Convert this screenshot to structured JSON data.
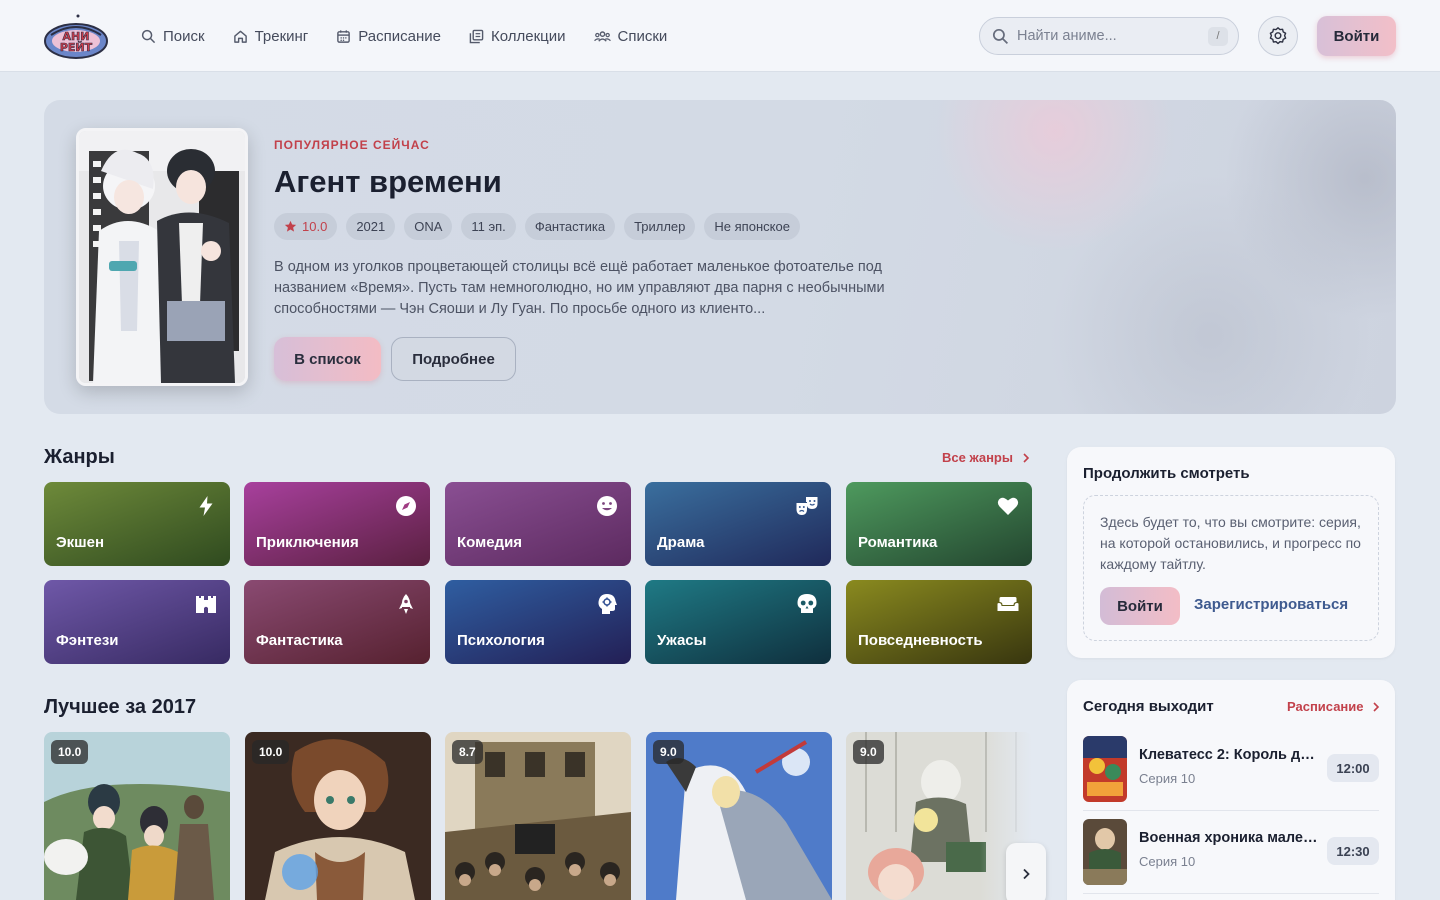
{
  "header": {
    "nav": [
      {
        "label": "Поиск",
        "icon": "search-icon"
      },
      {
        "label": "Трекинг",
        "icon": "home-icon"
      },
      {
        "label": "Расписание",
        "icon": "calendar-icon"
      },
      {
        "label": "Коллекции",
        "icon": "collections-icon"
      },
      {
        "label": "Списки",
        "icon": "users-icon"
      }
    ],
    "search_placeholder": "Найти аниме...",
    "search_shortcut": "/",
    "login_label": "Войти"
  },
  "hero": {
    "kicker": "ПОПУЛЯРНОЕ СЕЙЧАС",
    "title": "Агент времени",
    "rating": "10.0",
    "chips": [
      "2021",
      "ONA",
      "11 эп.",
      "Фантастика",
      "Триллер",
      "Не японское"
    ],
    "description": "В одном из уголков процветающей столицы всё ещё работает маленькое фотоателье под названием «Время». Пусть там немноголюдно, но им управляют два парня с необычными способностями — Чэн Сяоши и Лу Гуан. По просьбе одного из клиенто...",
    "add_label": "В список",
    "more_label": "Подробнее"
  },
  "genres": {
    "title": "Жанры",
    "all_link": "Все жанры",
    "items": [
      {
        "label": "Экшен",
        "icon": "lightning-icon",
        "from": "#6e8a3a",
        "to": "#2f4a1f"
      },
      {
        "label": "Приключения",
        "icon": "compass-icon",
        "from": "#a8409d",
        "to": "#5a2040"
      },
      {
        "label": "Комедия",
        "icon": "smile-icon",
        "from": "#8a4f93",
        "to": "#5c2a5f"
      },
      {
        "label": "Драма",
        "icon": "masks-icon",
        "from": "#3a6f9e",
        "to": "#20295a"
      },
      {
        "label": "Романтика",
        "icon": "heart-icon",
        "from": "#4e9a5e",
        "to": "#23452f"
      },
      {
        "label": "Фэнтези",
        "icon": "castle-icon",
        "from": "#6f58a8",
        "to": "#372a62"
      },
      {
        "label": "Фантастика",
        "icon": "rocket-icon",
        "from": "#8a4a72",
        "to": "#56212f"
      },
      {
        "label": "Психология",
        "icon": "brain-icon",
        "from": "#2f5ea1",
        "to": "#231f55"
      },
      {
        "label": "Ужасы",
        "icon": "skull-icon",
        "from": "#1f7a85",
        "to": "#0f2f3d"
      },
      {
        "label": "Повседневность",
        "icon": "sofa-icon",
        "from": "#8a8a1f",
        "to": "#38360f"
      }
    ]
  },
  "best": {
    "title": "Лучшее за 2017",
    "cards": [
      {
        "score": "10.0",
        "palette": [
          "#b9d4d9",
          "#4b6b3f",
          "#2b3b2c",
          "#e8c14a"
        ]
      },
      {
        "score": "10.0",
        "palette": [
          "#3a2a22",
          "#8a5a3a",
          "#4a7ab0",
          "#e7d8c2"
        ]
      },
      {
        "score": "8.7",
        "palette": [
          "#d9cbb0",
          "#6b5a3f",
          "#3a3328",
          "#b0a080"
        ]
      },
      {
        "score": "9.0",
        "palette": [
          "#4f7bc9",
          "#c8d8f0",
          "#efefef",
          "#2a3b6a"
        ]
      },
      {
        "score": "9.0",
        "palette": [
          "#d8d8d2",
          "#6c7262",
          "#e8a89a",
          "#3b4a3a"
        ]
      }
    ]
  },
  "continue": {
    "title": "Продолжить смотреть",
    "text": "Здесь будет то, что вы смотрите: серия, на которой остановились, и прогресс по каждому тайтлу.",
    "login_label": "Войти",
    "register_label": "Зарегистрироваться"
  },
  "today": {
    "title": "Сегодня выходит",
    "link": "Расписание",
    "items": [
      {
        "name": "Клеватесс 2: Король де...",
        "episode": "Серия 10",
        "time": "12:00"
      },
      {
        "name": "Военная хроника мален...",
        "episode": "Серия 10",
        "time": "12:30"
      }
    ]
  },
  "colors": {
    "accent": "#c2414b",
    "link": "#3e5a8f",
    "background": "#e3e9f1"
  }
}
